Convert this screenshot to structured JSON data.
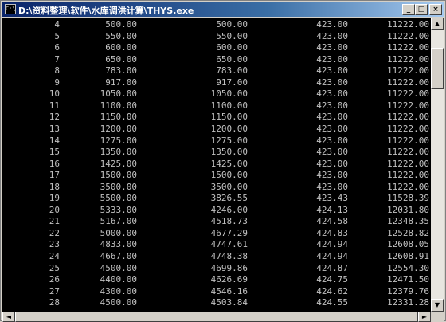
{
  "window": {
    "icon_label": "C:\\",
    "title": "D:\\资料整理\\软件\\水库调洪计算\\THYS.exe",
    "min_glyph": "_",
    "max_glyph": "□",
    "close_glyph": "×"
  },
  "scroll": {
    "up": "▲",
    "down": "▼",
    "left": "◄",
    "right": "►"
  },
  "rows": [
    [
      "4",
      "500.00",
      "500.00",
      "423.00",
      "11222.00"
    ],
    [
      "5",
      "550.00",
      "550.00",
      "423.00",
      "11222.00"
    ],
    [
      "6",
      "600.00",
      "600.00",
      "423.00",
      "11222.00"
    ],
    [
      "7",
      "650.00",
      "650.00",
      "423.00",
      "11222.00"
    ],
    [
      "8",
      "783.00",
      "783.00",
      "423.00",
      "11222.00"
    ],
    [
      "9",
      "917.00",
      "917.00",
      "423.00",
      "11222.00"
    ],
    [
      "10",
      "1050.00",
      "1050.00",
      "423.00",
      "11222.00"
    ],
    [
      "11",
      "1100.00",
      "1100.00",
      "423.00",
      "11222.00"
    ],
    [
      "12",
      "1150.00",
      "1150.00",
      "423.00",
      "11222.00"
    ],
    [
      "13",
      "1200.00",
      "1200.00",
      "423.00",
      "11222.00"
    ],
    [
      "14",
      "1275.00",
      "1275.00",
      "423.00",
      "11222.00"
    ],
    [
      "15",
      "1350.00",
      "1350.00",
      "423.00",
      "11222.00"
    ],
    [
      "16",
      "1425.00",
      "1425.00",
      "423.00",
      "11222.00"
    ],
    [
      "17",
      "1500.00",
      "1500.00",
      "423.00",
      "11222.00"
    ],
    [
      "18",
      "3500.00",
      "3500.00",
      "423.00",
      "11222.00"
    ],
    [
      "19",
      "5500.00",
      "3826.55",
      "423.43",
      "11528.39"
    ],
    [
      "20",
      "5333.00",
      "4246.00",
      "424.13",
      "12031.80"
    ],
    [
      "21",
      "5167.00",
      "4518.73",
      "424.58",
      "12348.35"
    ],
    [
      "22",
      "5000.00",
      "4677.29",
      "424.83",
      "12528.82"
    ],
    [
      "23",
      "4833.00",
      "4747.61",
      "424.94",
      "12608.05"
    ],
    [
      "24",
      "4667.00",
      "4748.38",
      "424.94",
      "12608.91"
    ],
    [
      "25",
      "4500.00",
      "4699.86",
      "424.87",
      "12554.30"
    ],
    [
      "26",
      "4400.00",
      "4626.69",
      "424.75",
      "12471.50"
    ],
    [
      "27",
      "4300.00",
      "4546.16",
      "424.62",
      "12379.76"
    ],
    [
      "28",
      "4500.00",
      "4503.84",
      "424.55",
      "12331.28"
    ]
  ]
}
